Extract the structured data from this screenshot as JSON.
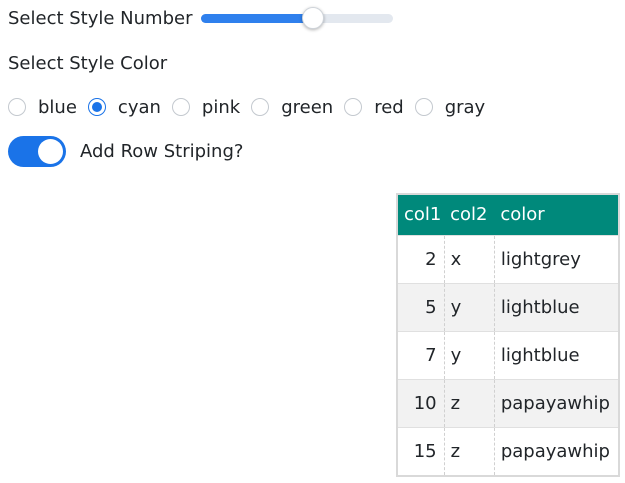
{
  "slider": {
    "label": "Select Style Number",
    "value_fraction": 0.59,
    "accent_color": "#2f80ed"
  },
  "color_select": {
    "label": "Select Style Color",
    "selected": "cyan",
    "options": [
      "blue",
      "cyan",
      "pink",
      "green",
      "red",
      "gray"
    ]
  },
  "striping_toggle": {
    "label": "Add Row Striping?",
    "on": true,
    "accent_color": "#1a73e8"
  },
  "table": {
    "header_color": "#00897b",
    "columns": [
      "col1",
      "col2",
      "color"
    ],
    "rows": [
      [
        "2",
        "x",
        "lightgrey"
      ],
      [
        "5",
        "y",
        "lightblue"
      ],
      [
        "7",
        "y",
        "lightblue"
      ],
      [
        "10",
        "z",
        "papayawhip"
      ],
      [
        "15",
        "z",
        "papayawhip"
      ]
    ]
  }
}
